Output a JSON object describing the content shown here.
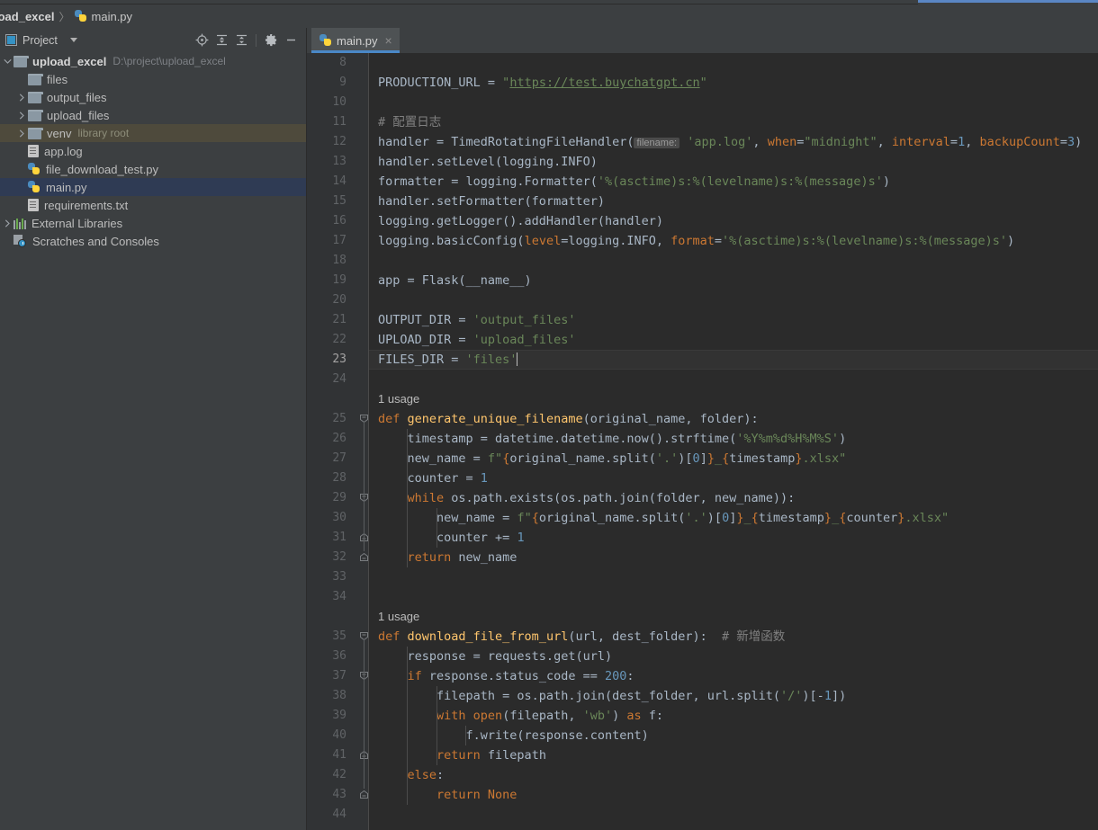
{
  "window": {
    "accent_color": "#5a86c4",
    "bg": "#3c3f41",
    "editor_bg": "#2b2b2b"
  },
  "breadcrumb": {
    "project": "load_excel",
    "separator": "〉",
    "file": "main.py"
  },
  "tool_window": {
    "title": "Project",
    "icons": [
      {
        "name": "locate-icon",
        "glyph": "target"
      },
      {
        "name": "expand-all-icon",
        "glyph": "expand"
      },
      {
        "name": "collapse-all-icon",
        "glyph": "collapse"
      },
      {
        "name": "settings-gear-icon",
        "glyph": "gear"
      },
      {
        "name": "hide-icon",
        "glyph": "minus"
      }
    ]
  },
  "tree": {
    "items": [
      {
        "label": "upload_excel",
        "hint": "D:\\project\\upload_excel",
        "type": "folder-root",
        "expanded": true,
        "arrow": "down",
        "indent": 0,
        "bold": true
      },
      {
        "label": "files",
        "hint": "",
        "type": "folder",
        "arrow": "none",
        "indent": 1
      },
      {
        "label": "output_files",
        "hint": "",
        "type": "folder",
        "arrow": "right",
        "indent": 1
      },
      {
        "label": "upload_files",
        "hint": "",
        "type": "folder",
        "arrow": "right",
        "indent": 1
      },
      {
        "label": "venv",
        "hint": "library root",
        "type": "folder",
        "arrow": "right",
        "indent": 1,
        "highlight": "venv"
      },
      {
        "label": "app.log",
        "hint": "",
        "type": "file-log",
        "arrow": "none",
        "indent": 1
      },
      {
        "label": "file_download_test.py",
        "hint": "",
        "type": "file-py",
        "arrow": "none",
        "indent": 1
      },
      {
        "label": "main.py",
        "hint": "",
        "type": "file-py",
        "arrow": "none",
        "indent": 1,
        "highlight": "selected"
      },
      {
        "label": "requirements.txt",
        "hint": "",
        "type": "file-txt",
        "arrow": "none",
        "indent": 1
      },
      {
        "label": "External Libraries",
        "hint": "",
        "type": "ext-lib",
        "arrow": "right",
        "indent": 0
      },
      {
        "label": "Scratches and Consoles",
        "hint": "",
        "type": "scratches",
        "arrow": "none",
        "indent": 0
      }
    ]
  },
  "tabs": [
    {
      "label": "main.py",
      "icon": "python-file-icon",
      "active": true,
      "close": "×"
    }
  ],
  "editor": {
    "first_line": 8,
    "last_line": 44,
    "cursor_line": 23,
    "lines": [
      {
        "n": 8,
        "tokens": []
      },
      {
        "n": 9,
        "tokens": [
          {
            "t": "PRODUCTION_URL = ",
            "c": "d"
          },
          {
            "t": "\"",
            "c": "s"
          },
          {
            "t": "https://test.buychatgpt.cn",
            "c": "url"
          },
          {
            "t": "\"",
            "c": "s"
          }
        ]
      },
      {
        "n": 10,
        "tokens": []
      },
      {
        "n": 11,
        "tokens": [
          {
            "t": "# 配置日志",
            "c": "c"
          }
        ]
      },
      {
        "n": 12,
        "tokens": [
          {
            "t": "handler = TimedRotatingFileHandler(",
            "c": "d"
          },
          {
            "t": "filename:",
            "c": "hint"
          },
          {
            "t": " ",
            "c": "d"
          },
          {
            "t": "'app.log'",
            "c": "s"
          },
          {
            "t": ", ",
            "c": "d"
          },
          {
            "t": "when",
            "c": "k"
          },
          {
            "t": "=",
            "c": "d"
          },
          {
            "t": "\"midnight\"",
            "c": "s"
          },
          {
            "t": ", ",
            "c": "d"
          },
          {
            "t": "interval",
            "c": "k"
          },
          {
            "t": "=",
            "c": "d"
          },
          {
            "t": "1",
            "c": "n"
          },
          {
            "t": ", ",
            "c": "d"
          },
          {
            "t": "backupCount",
            "c": "k"
          },
          {
            "t": "=",
            "c": "d"
          },
          {
            "t": "3",
            "c": "n"
          },
          {
            "t": ")",
            "c": "d"
          }
        ]
      },
      {
        "n": 13,
        "tokens": [
          {
            "t": "handler.setLevel(logging.INFO)",
            "c": "d"
          }
        ]
      },
      {
        "n": 14,
        "tokens": [
          {
            "t": "formatter = logging.Formatter(",
            "c": "d"
          },
          {
            "t": "'%(asctime)s:%(levelname)s:%(message)s'",
            "c": "s"
          },
          {
            "t": ")",
            "c": "d"
          }
        ]
      },
      {
        "n": 15,
        "tokens": [
          {
            "t": "handler.setFormatter(formatter)",
            "c": "d"
          }
        ]
      },
      {
        "n": 16,
        "tokens": [
          {
            "t": "logging.getLogger().addHandler(handler)",
            "c": "d"
          }
        ]
      },
      {
        "n": 17,
        "tokens": [
          {
            "t": "logging.basicConfig(",
            "c": "d"
          },
          {
            "t": "level",
            "c": "k"
          },
          {
            "t": "=logging.INFO, ",
            "c": "d"
          },
          {
            "t": "format",
            "c": "k"
          },
          {
            "t": "=",
            "c": "d"
          },
          {
            "t": "'%(asctime)s:%(levelname)s:%(message)s'",
            "c": "s"
          },
          {
            "t": ")",
            "c": "d"
          }
        ]
      },
      {
        "n": 18,
        "tokens": []
      },
      {
        "n": 19,
        "tokens": [
          {
            "t": "app = Flask(__name__)",
            "c": "d"
          }
        ]
      },
      {
        "n": 20,
        "tokens": []
      },
      {
        "n": 21,
        "tokens": [
          {
            "t": "OUTPUT_DIR = ",
            "c": "d"
          },
          {
            "t": "'output_files'",
            "c": "s"
          }
        ]
      },
      {
        "n": 22,
        "tokens": [
          {
            "t": "UPLOAD_DIR = ",
            "c": "d"
          },
          {
            "t": "'upload_files'",
            "c": "s"
          }
        ]
      },
      {
        "n": 23,
        "tokens": [
          {
            "t": "FILES_DIR = ",
            "c": "d"
          },
          {
            "t": "'files'",
            "c": "s"
          },
          {
            "t": "|",
            "c": "caret"
          }
        ]
      },
      {
        "n": 24,
        "tokens": []
      },
      {
        "n": 25,
        "usage": "1 usage",
        "tokens": [
          {
            "t": "def ",
            "c": "k"
          },
          {
            "t": "generate_unique_filename",
            "c": "f"
          },
          {
            "t": "(original_name, folder):",
            "c": "d"
          }
        ]
      },
      {
        "n": 26,
        "tokens": [
          {
            "t": "    timestamp = datetime.datetime.now().strftime(",
            "c": "d"
          },
          {
            "t": "'%Y%m%d%H%M%S'",
            "c": "s"
          },
          {
            "t": ")",
            "c": "d"
          }
        ]
      },
      {
        "n": 27,
        "tokens": [
          {
            "t": "    new_name = ",
            "c": "d"
          },
          {
            "t": "f\"",
            "c": "s"
          },
          {
            "t": "{",
            "c": "brace"
          },
          {
            "t": "original_name.split(",
            "c": "d"
          },
          {
            "t": "'.'",
            "c": "s"
          },
          {
            "t": ")[",
            "c": "d"
          },
          {
            "t": "0",
            "c": "n"
          },
          {
            "t": "]",
            "c": "d"
          },
          {
            "t": "}",
            "c": "brace"
          },
          {
            "t": "_",
            "c": "s"
          },
          {
            "t": "{",
            "c": "brace"
          },
          {
            "t": "timestamp",
            "c": "d"
          },
          {
            "t": "}",
            "c": "brace"
          },
          {
            "t": ".xlsx\"",
            "c": "s"
          }
        ]
      },
      {
        "n": 28,
        "tokens": [
          {
            "t": "    counter = ",
            "c": "d"
          },
          {
            "t": "1",
            "c": "n"
          }
        ]
      },
      {
        "n": 29,
        "tokens": [
          {
            "t": "    while ",
            "c": "k"
          },
          {
            "t": "os.path.exists(os.path.join(folder, new_name)):",
            "c": "d"
          }
        ]
      },
      {
        "n": 30,
        "tokens": [
          {
            "t": "        new_name = ",
            "c": "d"
          },
          {
            "t": "f\"",
            "c": "s"
          },
          {
            "t": "{",
            "c": "brace"
          },
          {
            "t": "original_name.split(",
            "c": "d"
          },
          {
            "t": "'.'",
            "c": "s"
          },
          {
            "t": ")[",
            "c": "d"
          },
          {
            "t": "0",
            "c": "n"
          },
          {
            "t": "]",
            "c": "d"
          },
          {
            "t": "}",
            "c": "brace"
          },
          {
            "t": "_",
            "c": "s"
          },
          {
            "t": "{",
            "c": "brace"
          },
          {
            "t": "timestamp",
            "c": "d"
          },
          {
            "t": "}",
            "c": "brace"
          },
          {
            "t": "_",
            "c": "s"
          },
          {
            "t": "{",
            "c": "brace"
          },
          {
            "t": "counter",
            "c": "d"
          },
          {
            "t": "}",
            "c": "brace"
          },
          {
            "t": ".xlsx\"",
            "c": "s"
          }
        ]
      },
      {
        "n": 31,
        "tokens": [
          {
            "t": "        counter += ",
            "c": "d"
          },
          {
            "t": "1",
            "c": "n"
          }
        ]
      },
      {
        "n": 32,
        "tokens": [
          {
            "t": "    return ",
            "c": "k"
          },
          {
            "t": "new_name",
            "c": "d"
          }
        ]
      },
      {
        "n": 33,
        "tokens": []
      },
      {
        "n": 34,
        "tokens": []
      },
      {
        "n": 35,
        "usage": "1 usage",
        "tokens": [
          {
            "t": "def ",
            "c": "k"
          },
          {
            "t": "download_file_from_url",
            "c": "f"
          },
          {
            "t": "(url, dest_folder):  ",
            "c": "d"
          },
          {
            "t": "# 新增函数",
            "c": "c"
          }
        ]
      },
      {
        "n": 36,
        "tokens": [
          {
            "t": "    response = requests.get(url)",
            "c": "d"
          }
        ]
      },
      {
        "n": 37,
        "tokens": [
          {
            "t": "    if ",
            "c": "k"
          },
          {
            "t": "response.status_code == ",
            "c": "d"
          },
          {
            "t": "200",
            "c": "n"
          },
          {
            "t": ":",
            "c": "d"
          }
        ]
      },
      {
        "n": 38,
        "tokens": [
          {
            "t": "        filepath = os.path.join(dest_folder, url.split(",
            "c": "d"
          },
          {
            "t": "'/'",
            "c": "s"
          },
          {
            "t": ")[-",
            "c": "d"
          },
          {
            "t": "1",
            "c": "n"
          },
          {
            "t": "])",
            "c": "d"
          }
        ]
      },
      {
        "n": 39,
        "tokens": [
          {
            "t": "        with ",
            "c": "k"
          },
          {
            "t": "open",
            "c": "k"
          },
          {
            "t": "(filepath, ",
            "c": "d"
          },
          {
            "t": "'wb'",
            "c": "s"
          },
          {
            "t": ") ",
            "c": "d"
          },
          {
            "t": "as ",
            "c": "k"
          },
          {
            "t": "f:",
            "c": "d"
          }
        ]
      },
      {
        "n": 40,
        "tokens": [
          {
            "t": "            f.write(response.content)",
            "c": "d"
          }
        ]
      },
      {
        "n": 41,
        "tokens": [
          {
            "t": "        return ",
            "c": "k"
          },
          {
            "t": "filepath",
            "c": "d"
          }
        ]
      },
      {
        "n": 42,
        "tokens": [
          {
            "t": "    else",
            "c": "k"
          },
          {
            "t": ":",
            "c": "d"
          }
        ]
      },
      {
        "n": 43,
        "tokens": [
          {
            "t": "        return ",
            "c": "k"
          },
          {
            "t": "None",
            "c": "k"
          }
        ]
      },
      {
        "n": 44,
        "tokens": []
      }
    ],
    "fold_markers": [
      {
        "line": 25,
        "type": "open"
      },
      {
        "line": 29,
        "type": "open"
      },
      {
        "line": 31,
        "type": "end"
      },
      {
        "line": 32,
        "type": "end"
      },
      {
        "line": 35,
        "type": "open"
      },
      {
        "line": 37,
        "type": "open"
      },
      {
        "line": 41,
        "type": "end"
      },
      {
        "line": 43,
        "type": "end"
      }
    ]
  }
}
